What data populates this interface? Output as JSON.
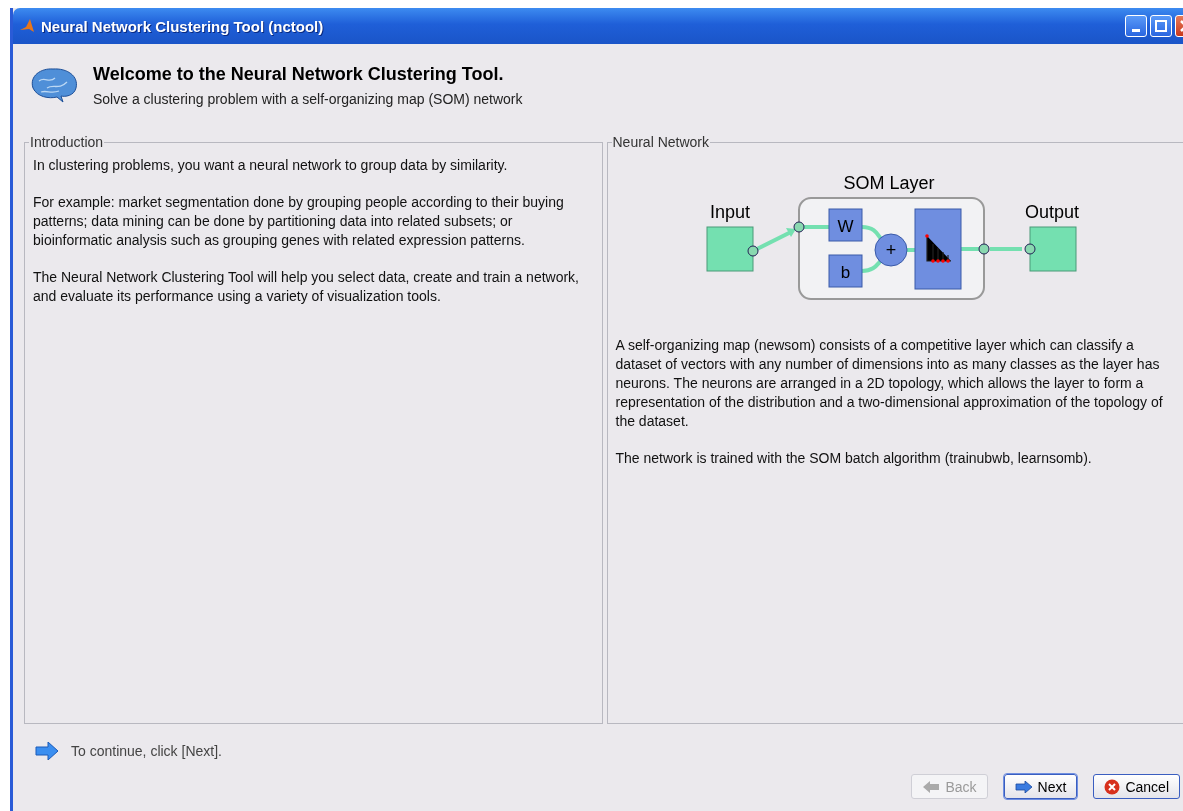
{
  "window": {
    "title": "Neural Network Clustering Tool (nctool)"
  },
  "header": {
    "title": "Welcome to the Neural Network Clustering Tool.",
    "subtitle": "Solve a clustering problem with a self-organizing map (SOM) network"
  },
  "introduction": {
    "legend": "Introduction",
    "paragraphs": [
      "In clustering problems, you want a neural network to group data by similarity.",
      "For example:  market segmentation done by grouping people according to their buying patterns; data mining can be done by partitioning data into related subsets; or bioinformatic analysis such as  grouping genes with related expression patterns.",
      "The Neural Network Clustering Tool will help you select data, create and train a network, and evaluate its performance using a variety of visualization tools."
    ]
  },
  "neural_network": {
    "legend": "Neural Network",
    "diagram": {
      "input_label": "Input",
      "layer_label": "SOM Layer",
      "output_label": "Output",
      "weight_label": "W",
      "bias_label": "b",
      "sum_label": "+"
    },
    "paragraphs": [
      "A self-organizing map (newsom) consists of a competitive layer which can classify a dataset of vectors with any number of dimensions into as many classes as the layer has neurons. The neurons are arranged in a 2D topology, which allows the layer to form a representation of the distribution and a two-dimensional approximation of the topology of the dataset.",
      "The network is trained with the SOM batch algorithm (trainubwb, learnsomb)."
    ]
  },
  "hint": "To continue, click [Next].",
  "buttons": [
    {
      "label": "Back",
      "kind": "back",
      "disabled": true
    },
    {
      "label": "Next",
      "kind": "next",
      "disabled": false
    },
    {
      "label": "Cancel",
      "kind": "cancel",
      "disabled": false
    }
  ]
}
